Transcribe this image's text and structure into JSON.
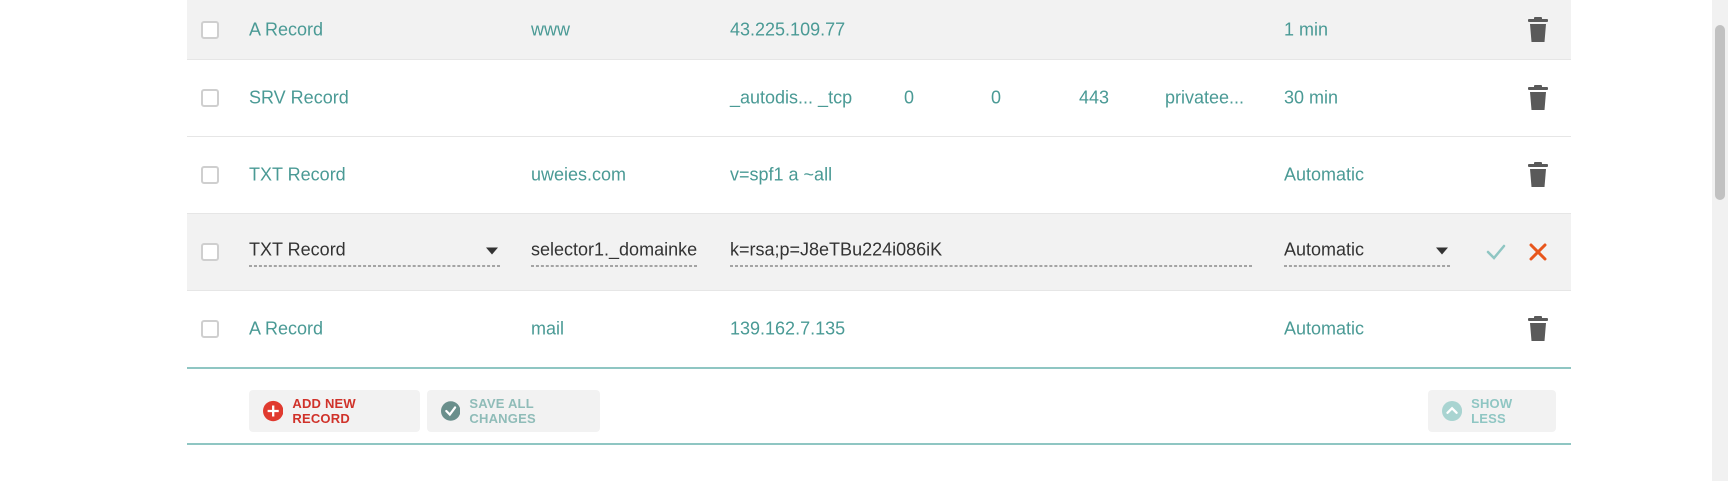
{
  "records": [
    {
      "type": "A Record",
      "host": "www",
      "value": "43.225.109.77",
      "ttl": "1 min"
    },
    {
      "type": "SRV Record",
      "host": "",
      "value": "_autodis... _tcp",
      "priority": "0",
      "weight": "0",
      "port": "443",
      "target": "privatee...",
      "ttl": "30 min"
    },
    {
      "type": "TXT Record",
      "host": "uweies.com",
      "value": "v=spf1 a ~all",
      "ttl": "Automatic"
    },
    {
      "type": "TXT Record",
      "host": "selector1._domainke",
      "value": "k=rsa;p=J8eTBu224i086iK",
      "ttl": "Automatic",
      "editing": true
    },
    {
      "type": "A Record",
      "host": "mail",
      "value": "139.162.7.135",
      "ttl": "Automatic"
    }
  ],
  "footer": {
    "add_label": "ADD NEW RECORD",
    "save_label": "SAVE ALL CHANGES",
    "less_label": "SHOW LESS"
  },
  "icons": {
    "delete": "trash-icon",
    "add": "plus-circle-icon",
    "save": "check-circle-icon",
    "less": "chevron-up-circle-icon",
    "confirm": "check-icon",
    "cancel": "close-icon",
    "dropdown": "caret-down-icon"
  },
  "colors": {
    "accent": "#4a9a95",
    "danger": "#d0322a",
    "row_highlight": "#f2f2f2",
    "divider": "#8fc6c3"
  }
}
